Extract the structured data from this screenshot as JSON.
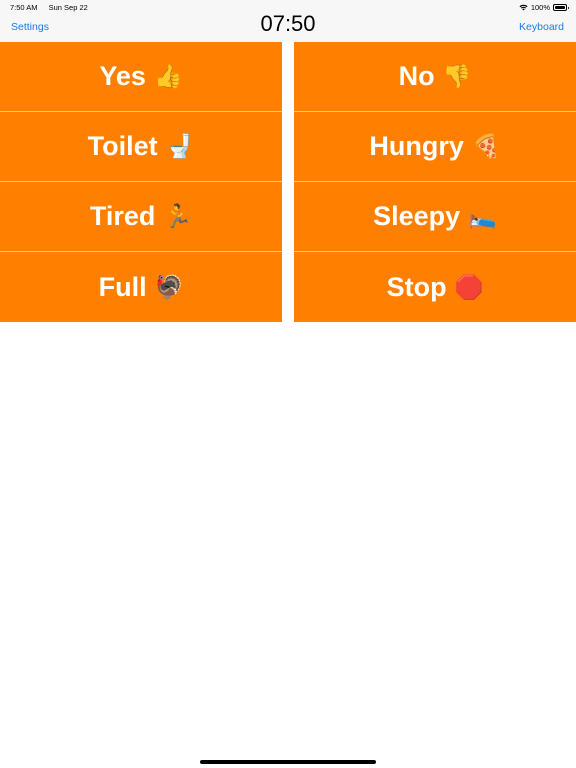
{
  "status_bar": {
    "time": "7:50 AM",
    "date": "Sun Sep 22",
    "battery_percent": "100%",
    "icons": [
      "wifi-icon",
      "battery-icon"
    ]
  },
  "nav": {
    "left_label": "Settings",
    "title": "07:50",
    "right_label": "Keyboard"
  },
  "colors": {
    "tile_background": "#ff8000",
    "tile_text": "#ffffff",
    "nav_link": "#1a7ce6"
  },
  "tiles": {
    "left": [
      {
        "label": "Yes",
        "emoji": "👍"
      },
      {
        "label": "Toilet",
        "emoji": "🚽"
      },
      {
        "label": "Tired",
        "emoji": "🏃"
      },
      {
        "label": "Full",
        "emoji": "🦃"
      }
    ],
    "right": [
      {
        "label": "No",
        "emoji": "👎"
      },
      {
        "label": "Hungry",
        "emoji": "🍕"
      },
      {
        "label": "Sleepy",
        "emoji": "🛌"
      },
      {
        "label": "Stop",
        "emoji": "🛑"
      }
    ]
  }
}
